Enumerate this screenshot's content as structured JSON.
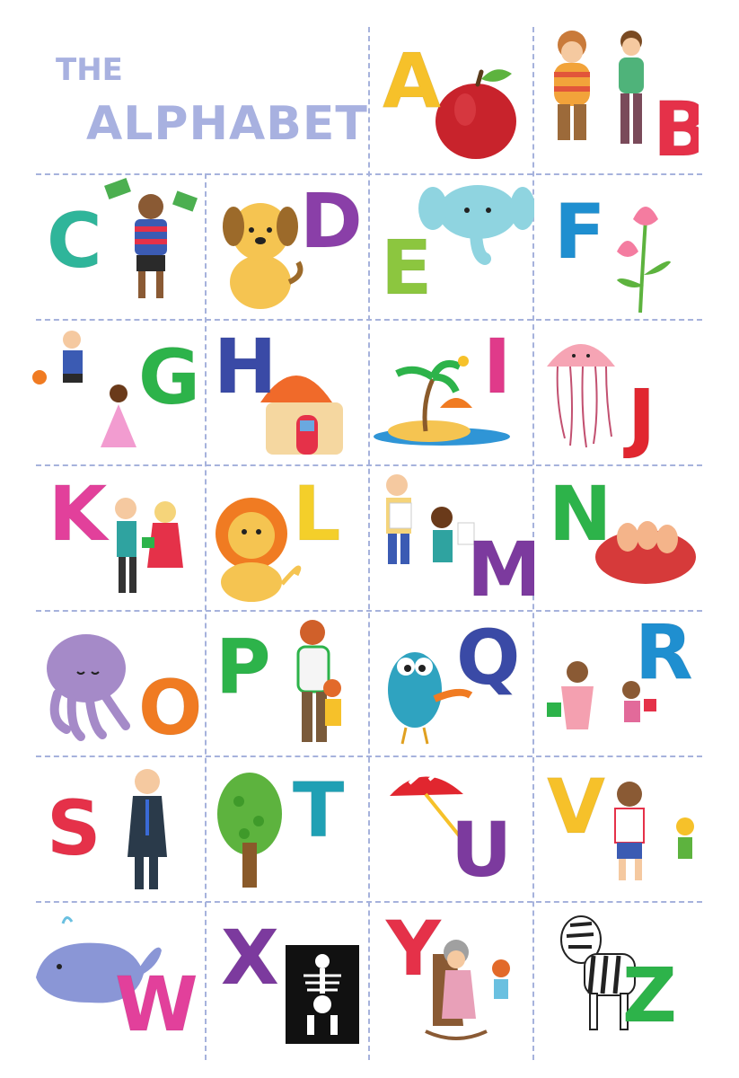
{
  "title": {
    "line1": "THE",
    "line2": "ALPHABET"
  },
  "colors": {
    "title": "#a8b1e0",
    "divider": "#a6b2dc"
  },
  "letters": [
    {
      "char": "A",
      "color": "#f6c12a",
      "picture": "apple"
    },
    {
      "char": "B",
      "color": "#e53149",
      "picture": "boys"
    },
    {
      "char": "C",
      "color": "#2fb59a",
      "picture": "child-with-cash"
    },
    {
      "char": "D",
      "color": "#8a3fa8",
      "picture": "dog"
    },
    {
      "char": "E",
      "color": "#8cc63f",
      "picture": "elephant"
    },
    {
      "char": "F",
      "color": "#1f8fd0",
      "picture": "flower"
    },
    {
      "char": "G",
      "color": "#2db34a",
      "picture": "girl-and-boy"
    },
    {
      "char": "H",
      "color": "#3a4aa6",
      "picture": "house"
    },
    {
      "char": "I",
      "color": "#e03a8a",
      "picture": "island"
    },
    {
      "char": "J",
      "color": "#e1262f",
      "picture": "jellyfish"
    },
    {
      "char": "K",
      "color": "#e2409b",
      "picture": "kids-gift"
    },
    {
      "char": "L",
      "color": "#f4cf2a",
      "picture": "lion"
    },
    {
      "char": "M",
      "color": "#7c3a9e",
      "picture": "boys-drawing"
    },
    {
      "char": "N",
      "color": "#2db34a",
      "picture": "nest"
    },
    {
      "char": "O",
      "color": "#f07b22",
      "picture": "octopus"
    },
    {
      "char": "P",
      "color": "#2db34a",
      "picture": "parent-and-child"
    },
    {
      "char": "Q",
      "color": "#3a4aa6",
      "picture": "quail"
    },
    {
      "char": "R",
      "color": "#1f8fd0",
      "picture": "mother-and-daughter"
    },
    {
      "char": "S",
      "color": "#e53149",
      "picture": "suit-man"
    },
    {
      "char": "T",
      "color": "#1fa0b4",
      "picture": "tree"
    },
    {
      "char": "U",
      "color": "#7c3a9e",
      "picture": "umbrella"
    },
    {
      "char": "V",
      "color": "#f6c12a",
      "picture": "boy-and-child"
    },
    {
      "char": "W",
      "color": "#e2409b",
      "picture": "whale"
    },
    {
      "char": "X",
      "color": "#7c3a9e",
      "picture": "x-ray"
    },
    {
      "char": "Y",
      "color": "#e53149",
      "picture": "grandmother-in-rocking-chair"
    },
    {
      "char": "Z",
      "color": "#2db34a",
      "picture": "zebra"
    }
  ]
}
